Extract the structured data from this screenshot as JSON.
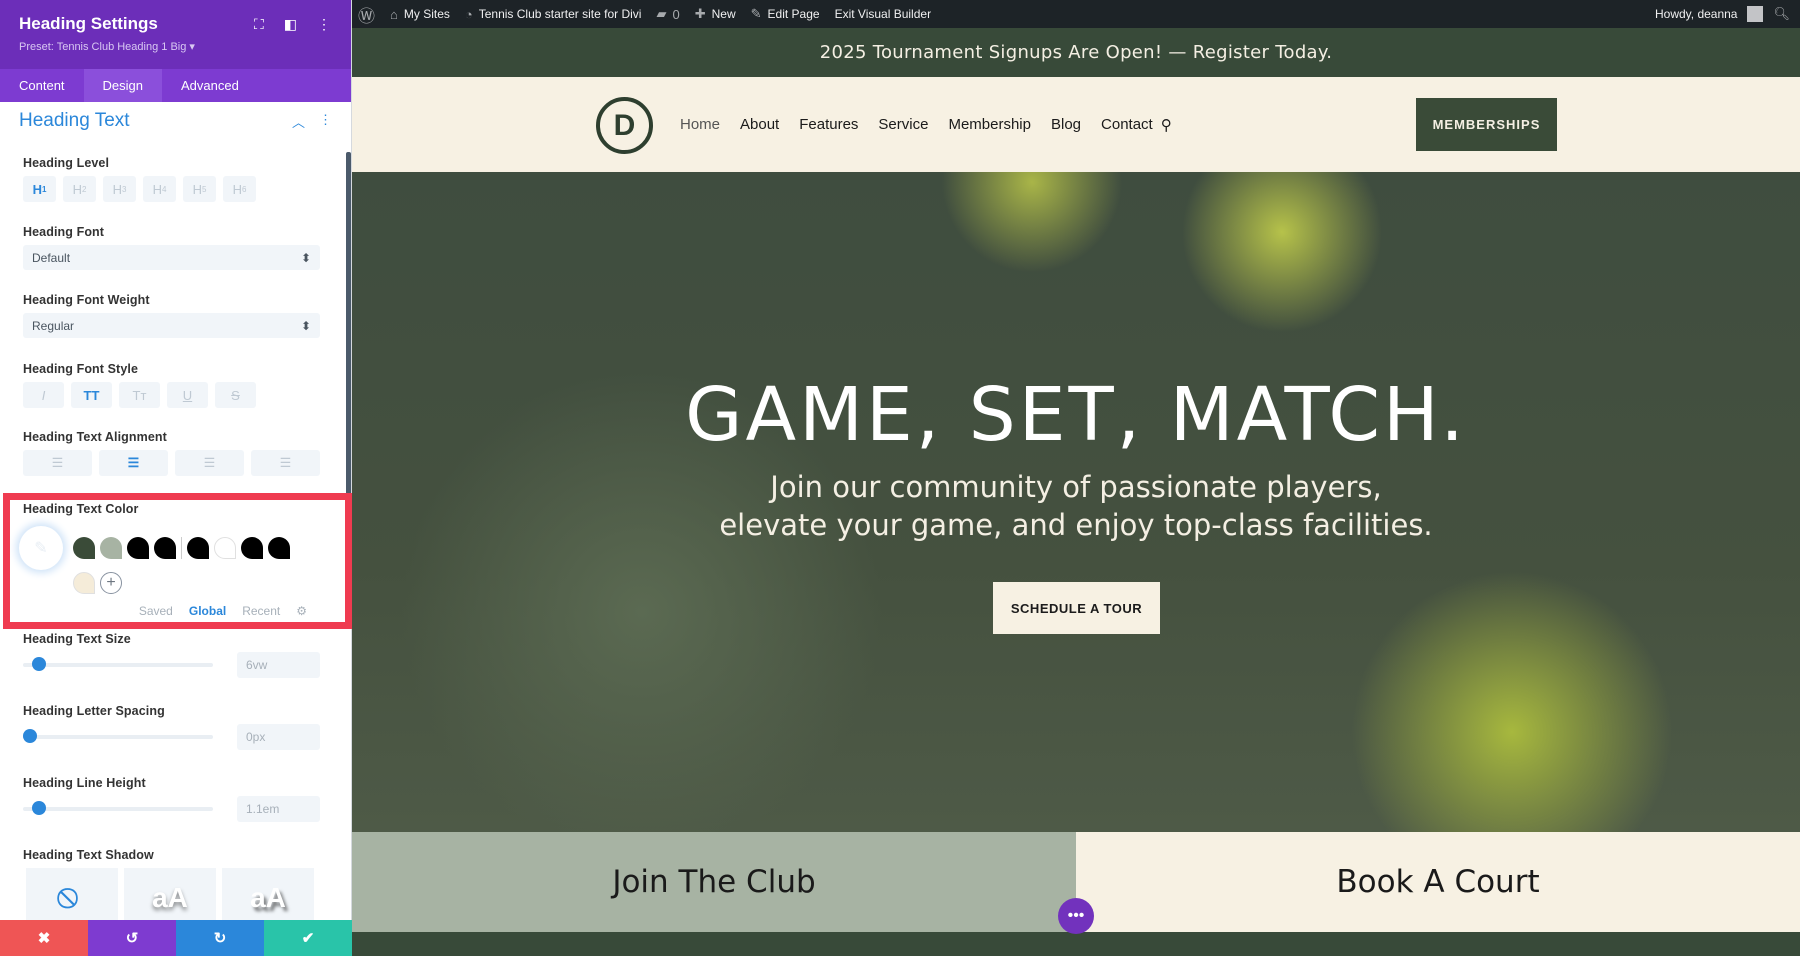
{
  "panel": {
    "title": "Heading Settings",
    "preset": "Preset: Tennis Club Heading 1 Big ▾",
    "tabs": [
      "Content",
      "Design",
      "Advanced"
    ],
    "active_tab": "Design",
    "section_title": "Heading Text",
    "heading_level": {
      "label": "Heading Level",
      "options": [
        "H1",
        "H2",
        "H3",
        "H4",
        "H5",
        "H6"
      ],
      "selected": "H1"
    },
    "heading_font": {
      "label": "Heading Font",
      "value": "Default"
    },
    "heading_font_weight": {
      "label": "Heading Font Weight",
      "value": "Regular"
    },
    "heading_font_style": {
      "label": "Heading Font Style",
      "options": [
        "I",
        "TT",
        "Tт",
        "U",
        "S"
      ],
      "selected": "TT"
    },
    "heading_text_alignment": {
      "label": "Heading Text Alignment",
      "selected": "center"
    },
    "heading_text_color": {
      "label": "Heading Text Color",
      "swatches": [
        "#3a4b38",
        "#a7b3a3",
        "#000000",
        "#000000",
        "#000000",
        "#ffffff",
        "#000000",
        "#000000",
        "#f5ecd9"
      ],
      "palette_tabs": [
        "Saved",
        "Global",
        "Recent"
      ],
      "active_palette_tab": "Global"
    },
    "heading_text_size": {
      "label": "Heading Text Size",
      "value": "6vw"
    },
    "heading_letter_spacing": {
      "label": "Heading Letter Spacing",
      "value": "0px"
    },
    "heading_line_height": {
      "label": "Heading Line Height",
      "value": "1.1em"
    },
    "heading_text_shadow": {
      "label": "Heading Text Shadow",
      "options": [
        "none",
        "aA",
        "aA"
      ]
    },
    "footer": {
      "cancel": "✖",
      "undo": "↺",
      "redo": "↻",
      "save": "✔"
    },
    "colors": {
      "header": "#6c2eb9",
      "tabs": "#7d3bd1",
      "accent": "#2b87da",
      "cancel": "#ef5555",
      "undo": "#7e3bd0",
      "redo": "#2b87da",
      "save": "#29c4a9"
    }
  },
  "adminbar": {
    "my_sites": "My Sites",
    "site_name": "Tennis Club starter site for Divi",
    "comments": "0",
    "new": "New",
    "edit_page": "Edit Page",
    "exit_builder": "Exit Visual Builder",
    "greeting": "Howdy, deanna"
  },
  "site": {
    "announcement": "2025 Tournament Signups Are Open! — Register Today.",
    "logo_letter": "D",
    "nav": [
      "Home",
      "About",
      "Features",
      "Service",
      "Membership",
      "Blog",
      "Contact"
    ],
    "memberships_button": "MEMBERSHIPS",
    "hero_title": "GAME, SET, MATCH.",
    "hero_line1": "Join our community of passionate players,",
    "hero_line2": "elevate your game, and enjoy top-class facilities.",
    "tour_button": "SCHEDULE A TOUR",
    "cta_left": "Join The Club",
    "cta_right": "Book A Court"
  }
}
